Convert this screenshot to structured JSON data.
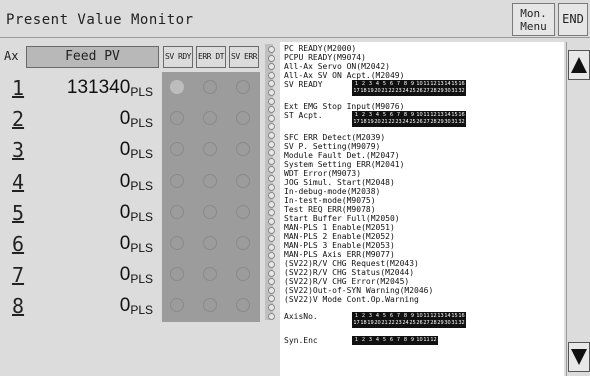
{
  "header": {
    "title": "Present Value Monitor",
    "menu_label_1": "Mon.",
    "menu_label_2": "Menu",
    "end_label": "END"
  },
  "columns": {
    "ax": "Ax",
    "feed_pv": "Feed PV",
    "sv_rdy": "SV RDY",
    "err_dt": "ERR DT",
    "sv_err": "SV ERR"
  },
  "axes": [
    {
      "num": "1",
      "value": "131340",
      "unit": "PLS",
      "sv_rdy": true
    },
    {
      "num": "2",
      "value": "0",
      "unit": "PLS",
      "sv_rdy": false
    },
    {
      "num": "3",
      "value": "0",
      "unit": "PLS",
      "sv_rdy": false
    },
    {
      "num": "4",
      "value": "0",
      "unit": "PLS",
      "sv_rdy": false
    },
    {
      "num": "5",
      "value": "0",
      "unit": "PLS",
      "sv_rdy": false
    },
    {
      "num": "6",
      "value": "0",
      "unit": "PLS",
      "sv_rdy": false
    },
    {
      "num": "7",
      "value": "0",
      "unit": "PLS",
      "sv_rdy": false
    },
    {
      "num": "8",
      "value": "0",
      "unit": "PLS",
      "sv_rdy": false
    }
  ],
  "status_lines": [
    "PC READY(M2000)",
    "PCPU READY(M9074)",
    "All-Ax Servo ON(M2042)",
    "All-Ax SV ON Acpt.(M2049)",
    "SV READY",
    "Ext EMG Stop Input(M9076)",
    "ST Acpt.",
    "SFC ERR Detect(M2039)",
    "SV P. Setting(M9079)",
    "Module Fault Det.(M2047)",
    "System Setting ERR(M2041)",
    "WDT Error(M9073)",
    "JOG Simul. Start(M2048)",
    "In-debug-mode(M2038)",
    "In-test-mode(M9075)",
    "Test REQ ERR(M9078)",
    "Start Buffer Full(M2050)",
    "MAN-PLS 1 Enable(M2051)",
    "MAN-PLS 2 Enable(M2052)",
    "MAN-PLS 3 Enable(M2053)",
    "MAN-PLS Axis ERR(M9077)",
    "(SV22)R/V CHG Request(M2043)",
    "(SV22)R/V CHG Status(M2044)",
    "(SV22)R/V CHG Error(M2045)",
    "(SV22)Out-of-SYN Warning(M2046)",
    "(SV22)V Mode Cont.Op.Warning",
    "AxisNo.",
    "Syn.Enc"
  ],
  "axis_grid_row1": [
    "1",
    "2",
    "3",
    "4",
    "5",
    "6",
    "7",
    "8",
    "9",
    "10",
    "11",
    "12",
    "13",
    "14",
    "15",
    "16"
  ],
  "axis_grid_row2": [
    "17",
    "18",
    "19",
    "20",
    "21",
    "22",
    "23",
    "24",
    "25",
    "26",
    "27",
    "28",
    "29",
    "30",
    "31",
    "32"
  ],
  "syn_enc_row": [
    "1",
    "2",
    "3",
    "4",
    "5",
    "6",
    "7",
    "8",
    "9",
    "10",
    "11",
    "12"
  ],
  "icons": {
    "scroll_up": "up-triangle-icon",
    "scroll_down": "down-triangle-icon"
  },
  "colors": {
    "background": "#dcdcdc",
    "grid": "#9c9c9c",
    "panel": "#ffffff",
    "text": "#111111"
  }
}
